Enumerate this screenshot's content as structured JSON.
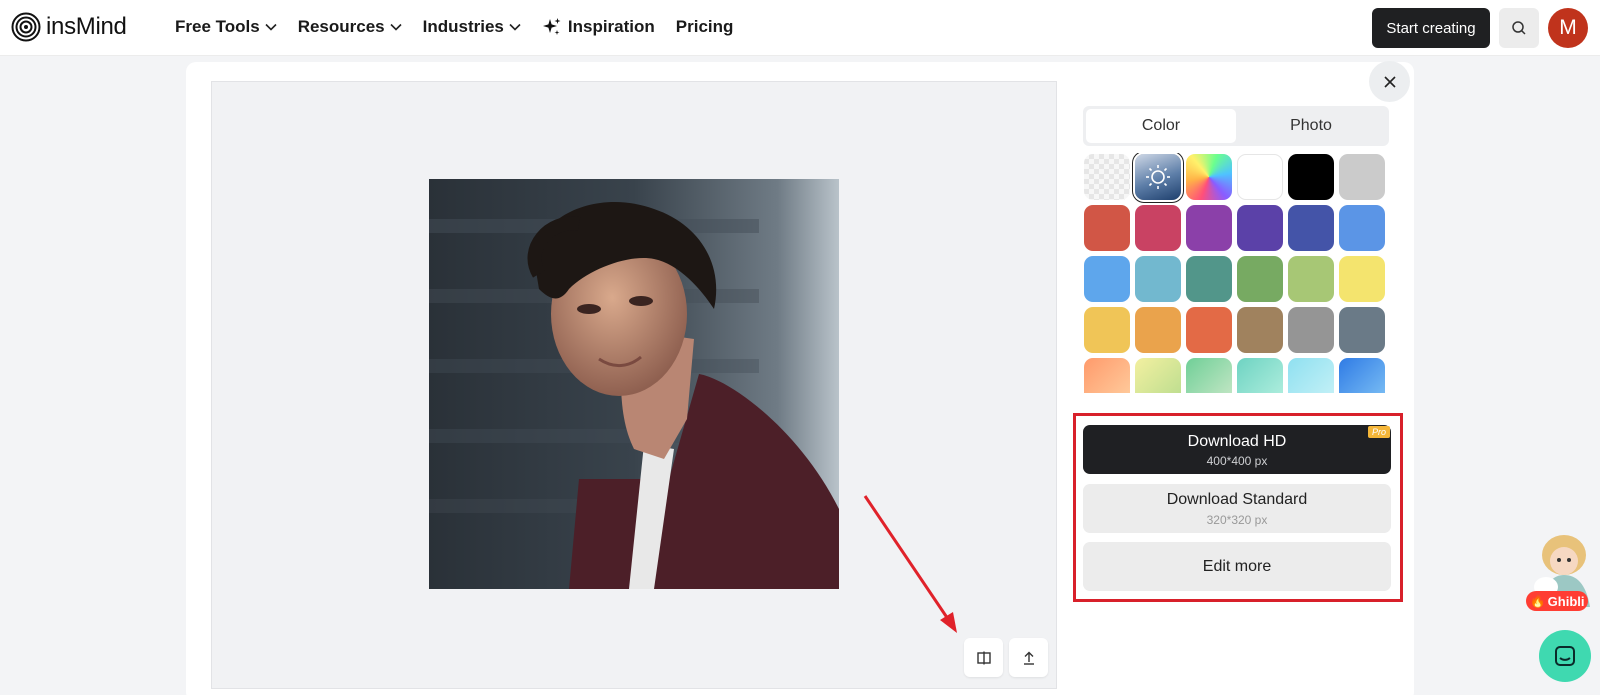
{
  "header": {
    "logo_text": "insMind",
    "nav": [
      {
        "label": "Free Tools",
        "has_dropdown": true
      },
      {
        "label": "Resources",
        "has_dropdown": true
      },
      {
        "label": "Industries",
        "has_dropdown": true
      },
      {
        "label": "Inspiration",
        "icon": "sparkle-icon"
      },
      {
        "label": "Pricing"
      }
    ],
    "start_button": "Start creating",
    "avatar_initial": "M"
  },
  "panel": {
    "tabs": [
      {
        "label": "Color",
        "active": true
      },
      {
        "label": "Photo",
        "active": false
      }
    ],
    "swatches": [
      [
        "transparent",
        "#1f4a82",
        "rainbow",
        "#ffffff",
        "#000000",
        "#cbcbcb"
      ],
      [
        "#d15646",
        "#c94263",
        "#8b40a9",
        "#5b41a8",
        "#4454a8",
        "#5b95e6"
      ],
      [
        "#5ea6ec",
        "#72b8cf",
        "#52968a",
        "#77aa62",
        "#a7c775",
        "#f4e46e"
      ],
      [
        "#f0c557",
        "#eaa34c",
        "#e36a46",
        "#a0825e",
        "#959595",
        "#6a7a87"
      ],
      [
        "grad-peach",
        "grad-yellowgreen",
        "grad-green",
        "grad-aqua",
        "grad-sky",
        "grad-blue"
      ]
    ],
    "selected_swatch": [
      0,
      1
    ],
    "download_hd": {
      "label": "Download HD",
      "size": "400*400 px",
      "badge": "Pro"
    },
    "download_standard": {
      "label": "Download Standard",
      "size": "320*320 px"
    },
    "edit_more": "Edit more"
  },
  "floating": {
    "ghibli_label": "Ghibli"
  },
  "colors": {
    "accent_dark": "#1f2022",
    "highlight_red": "#d8202a",
    "avatar": "#c0331c",
    "chat": "#3fd9b0"
  }
}
